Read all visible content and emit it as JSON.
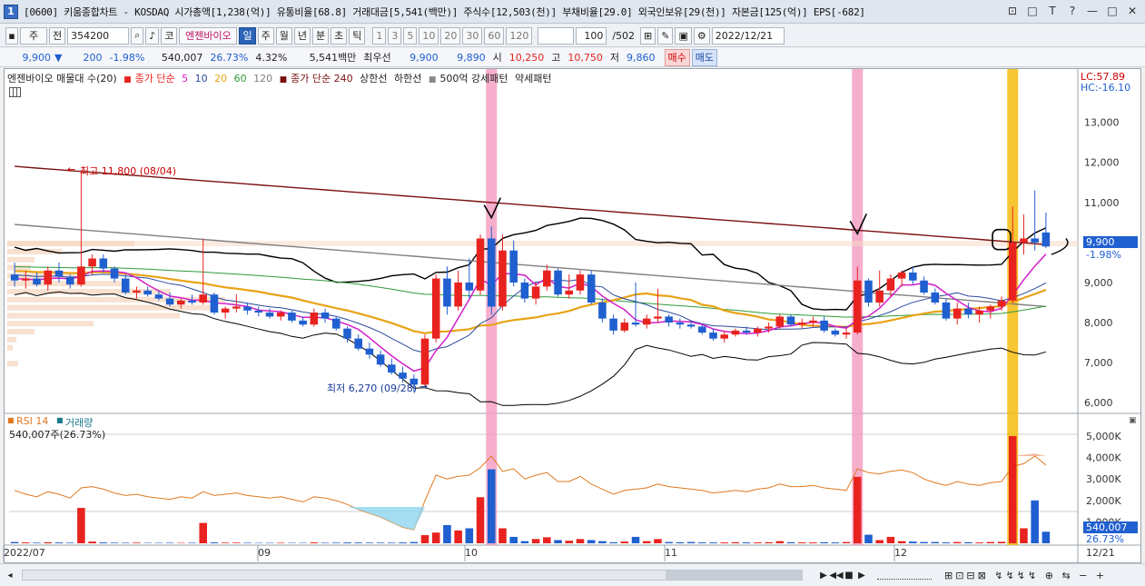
{
  "window": {
    "icon_num": "1",
    "title": "[0600] 키움종합차트 - KOSDAQ 시가총액[1,238(억)] 유통비율[68.8] 거래대금[5,541(백만)] 주식수[12,503(천)] 부채비율[29.0] 외국인보유[29(천)] 자본금[125(억)] EPS[-682]",
    "buttons": [
      "⊡",
      "□",
      "T",
      "?",
      "—",
      "□",
      "✕"
    ]
  },
  "toolbar": {
    "period": "주",
    "jeon": "전",
    "code": "354200",
    "market": "코",
    "stock_name": "엔젠바이오",
    "periods": [
      "일",
      "주",
      "월",
      "년",
      "분",
      "초",
      "틱"
    ],
    "selected_period": "일",
    "minutes": [
      "1",
      "3",
      "5",
      "10",
      "20",
      "30",
      "60",
      "120"
    ],
    "count": "100",
    "count_total": "/502",
    "date": "2022/12/21"
  },
  "quote": {
    "price": "9,900",
    "arrow": "▼",
    "change": "200",
    "change_pct": "-1.98%",
    "volume": "540,007",
    "vol_ratio": "26.73%",
    "turnover": "4.32%",
    "amount": "5,541백만",
    "best_ask_label": "최우선",
    "best_ask": "9,900",
    "best_bid": "9,890",
    "open_label": "시",
    "open": "10,250",
    "high_label": "고",
    "high": "10,750",
    "low_label": "저",
    "low": "9,860",
    "buy_label": "매수",
    "sell_label": "매도"
  },
  "legend": {
    "name": "엔젠바이오 매물대 수(20)",
    "ma_label": "종가 단순",
    "ma": [
      "5",
      "10",
      "20",
      "60",
      "120"
    ],
    "ma2_label": "종가 단순 240",
    "upper": "상한선",
    "lower": "하한선",
    "pattern": "500억 강세패턴",
    "weak": "약세패턴"
  },
  "colors": {
    "up": "#e8231f",
    "down": "#1f5fd0",
    "ma5": "#d21ec8",
    "ma10": "#2b4a9c",
    "ma20": "#e8a317",
    "ma60": "#2f9a3a",
    "ma120": "#808080",
    "ma240": "#7b1010",
    "band": "#000000",
    "highlight_pink": "#f49ac1",
    "highlight_gold": "#f5b800",
    "rsi": "#e07a20"
  },
  "right_axis": {
    "lc": "LC:57.89",
    "hc": "HC:-16.10",
    "prices": [
      "13,000",
      "12,000",
      "11,000",
      "10,000",
      "9,000",
      "8,000",
      "7,000",
      "6,000"
    ],
    "current": "9,900",
    "current_pct": "-1.98%",
    "volumes": [
      "5,000K",
      "4,000K",
      "3,000K",
      "2,000K",
      "1,000K"
    ],
    "vol_current": "540,007",
    "vol_pct": "26.73%"
  },
  "annotations": {
    "high": "최고 11,800 (08/04)",
    "low": "최저 6,270 (09/28)"
  },
  "sub": {
    "rsi": "RSI 14",
    "volume": "거래량",
    "vol_value": "540,007주(26.73%)"
  },
  "x_axis": [
    "2022/07",
    "09",
    "10",
    "11",
    "12",
    "12/21"
  ],
  "chart_data": {
    "type": "candlestick",
    "ohlc": [
      [
        9200,
        9500,
        8900,
        9050
      ],
      [
        9050,
        9300,
        8850,
        9100
      ],
      [
        9100,
        9250,
        8900,
        8950
      ],
      [
        8950,
        9400,
        8800,
        9300
      ],
      [
        9300,
        9500,
        9000,
        9150
      ],
      [
        9150,
        9200,
        8850,
        8950
      ],
      [
        8950,
        11800,
        8900,
        9400
      ],
      [
        9400,
        9700,
        9200,
        9600
      ],
      [
        9600,
        9700,
        9250,
        9350
      ],
      [
        9350,
        9400,
        9000,
        9100
      ],
      [
        9100,
        9200,
        8700,
        8750
      ],
      [
        8750,
        8900,
        8600,
        8800
      ],
      [
        8800,
        8900,
        8650,
        8700
      ],
      [
        8700,
        8800,
        8550,
        8600
      ],
      [
        8600,
        8750,
        8400,
        8450
      ],
      [
        8450,
        8600,
        8350,
        8550
      ],
      [
        8550,
        8700,
        8450,
        8500
      ],
      [
        8500,
        10100,
        8450,
        8700
      ],
      [
        8700,
        8750,
        8200,
        8250
      ],
      [
        8250,
        8400,
        8100,
        8350
      ],
      [
        8350,
        8700,
        8250,
        8400
      ],
      [
        8400,
        8500,
        8200,
        8300
      ],
      [
        8300,
        8400,
        8150,
        8250
      ],
      [
        8250,
        8350,
        8100,
        8150
      ],
      [
        8150,
        8300,
        8050,
        8250
      ],
      [
        8250,
        8300,
        8000,
        8050
      ],
      [
        8050,
        8150,
        7900,
        7950
      ],
      [
        7950,
        8350,
        7900,
        8250
      ],
      [
        8250,
        8350,
        8000,
        8100
      ],
      [
        8100,
        8150,
        7800,
        7850
      ],
      [
        7850,
        7900,
        7500,
        7600
      ],
      [
        7600,
        7700,
        7300,
        7350
      ],
      [
        7350,
        7500,
        7100,
        7200
      ],
      [
        7200,
        7300,
        6900,
        6950
      ],
      [
        6950,
        7100,
        6700,
        6750
      ],
      [
        6750,
        6900,
        6500,
        6600
      ],
      [
        6600,
        6700,
        6270,
        6450
      ],
      [
        6450,
        7700,
        6400,
        7600
      ],
      [
        7600,
        9200,
        7500,
        9100
      ],
      [
        9100,
        9400,
        8200,
        8400
      ],
      [
        8400,
        9300,
        8300,
        9000
      ],
      [
        9000,
        9600,
        8600,
        8800
      ],
      [
        8800,
        10200,
        8700,
        10100
      ],
      [
        10100,
        10400,
        8200,
        8400
      ],
      [
        8400,
        10200,
        8300,
        9800
      ],
      [
        9800,
        10050,
        8900,
        9000
      ],
      [
        9000,
        9100,
        8500,
        8600
      ],
      [
        8600,
        9000,
        8450,
        8900
      ],
      [
        8900,
        9450,
        8800,
        9300
      ],
      [
        9300,
        9350,
        8650,
        8700
      ],
      [
        8700,
        9200,
        8600,
        8800
      ],
      [
        8800,
        9300,
        8700,
        9200
      ],
      [
        9200,
        9300,
        8450,
        8500
      ],
      [
        8500,
        8600,
        8000,
        8100
      ],
      [
        8100,
        8200,
        7700,
        7800
      ],
      [
        7800,
        8100,
        7750,
        8000
      ],
      [
        8000,
        9000,
        7900,
        7950
      ],
      [
        7950,
        8200,
        7850,
        8100
      ],
      [
        8100,
        8850,
        8000,
        8150
      ],
      [
        8150,
        8200,
        7900,
        8000
      ],
      [
        8000,
        8100,
        7850,
        7950
      ],
      [
        7950,
        8050,
        7850,
        7900
      ],
      [
        7900,
        7950,
        7700,
        7750
      ],
      [
        7750,
        7850,
        7550,
        7600
      ],
      [
        7600,
        7800,
        7500,
        7700
      ],
      [
        7700,
        7850,
        7650,
        7800
      ],
      [
        7800,
        7900,
        7700,
        7750
      ],
      [
        7750,
        7900,
        7650,
        7850
      ],
      [
        7850,
        8000,
        7750,
        7900
      ],
      [
        7900,
        8200,
        7850,
        8150
      ],
      [
        8150,
        8200,
        7900,
        7950
      ],
      [
        7950,
        8100,
        7850,
        8000
      ],
      [
        8000,
        8150,
        7900,
        8050
      ],
      [
        8050,
        8150,
        7750,
        7800
      ],
      [
        7800,
        7850,
        7650,
        7700
      ],
      [
        7700,
        7850,
        7600,
        7750
      ],
      [
        7750,
        9400,
        7700,
        9050
      ],
      [
        9050,
        9100,
        8400,
        8500
      ],
      [
        8500,
        9300,
        8400,
        8800
      ],
      [
        8800,
        9200,
        8650,
        9100
      ],
      [
        9100,
        9300,
        8900,
        9250
      ],
      [
        9250,
        9400,
        8950,
        9050
      ],
      [
        9050,
        9150,
        8700,
        8750
      ],
      [
        8750,
        8850,
        8450,
        8500
      ],
      [
        8500,
        8600,
        8050,
        8100
      ],
      [
        8100,
        8500,
        7950,
        8350
      ],
      [
        8350,
        8500,
        8100,
        8200
      ],
      [
        8200,
        8400,
        8000,
        8300
      ],
      [
        8300,
        8450,
        8100,
        8400
      ],
      [
        8400,
        8650,
        8300,
        8550
      ],
      [
        8550,
        10900,
        8500,
        10000
      ],
      [
        10000,
        10700,
        9700,
        10100
      ],
      [
        10100,
        11300,
        9800,
        10000
      ],
      [
        10250,
        10750,
        9860,
        9900
      ]
    ],
    "volume_k": [
      60,
      40,
      30,
      50,
      40,
      30,
      1650,
      80,
      40,
      30,
      25,
      30,
      20,
      20,
      25,
      20,
      25,
      950,
      40,
      30,
      30,
      25,
      20,
      20,
      25,
      20,
      20,
      40,
      25,
      30,
      40,
      35,
      30,
      30,
      30,
      40,
      60,
      380,
      500,
      850,
      600,
      700,
      2150,
      3450,
      700,
      300,
      100,
      200,
      280,
      150,
      120,
      200,
      150,
      100,
      50,
      80,
      300,
      100,
      200,
      60,
      50,
      60,
      40,
      40,
      40,
      50,
      40,
      40,
      50,
      100,
      50,
      40,
      40,
      50,
      40,
      60,
      3100,
      400,
      150,
      300,
      100,
      80,
      60,
      60,
      40,
      60,
      50,
      40,
      60,
      70,
      5000,
      700,
      2000,
      540
    ],
    "rsi": [
      43,
      40,
      38,
      42,
      40,
      37,
      45,
      46,
      44,
      41,
      39,
      40,
      38,
      37,
      36,
      38,
      37,
      42,
      39,
      40,
      41,
      39,
      38,
      37,
      38,
      36,
      34,
      38,
      37,
      35,
      32,
      28,
      25,
      22,
      18,
      14,
      12,
      35,
      55,
      52,
      54,
      55,
      61,
      70,
      58,
      60,
      52,
      55,
      57,
      50,
      50,
      54,
      48,
      44,
      40,
      43,
      44,
      45,
      48,
      46,
      45,
      44,
      43,
      41,
      42,
      43,
      42,
      44,
      45,
      48,
      46,
      46,
      47,
      45,
      44,
      43,
      60,
      57,
      56,
      58,
      59,
      57,
      52,
      49,
      47,
      50,
      48,
      47,
      49,
      50,
      62,
      64,
      70,
      63
    ],
    "ylim": [
      5800,
      13900
    ],
    "vol_ylim": [
      0,
      5000
    ]
  }
}
